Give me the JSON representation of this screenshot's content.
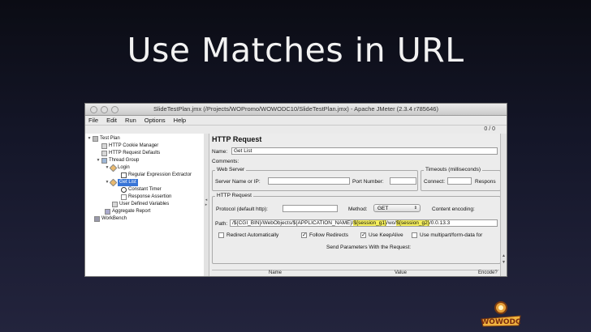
{
  "slide": {
    "title": "Use Matches in URL"
  },
  "window": {
    "title": "SlideTestPlan.jmx (/Projects/WOPromo/WOWODC10/SlideTestPlan.jmx) - Apache JMeter (2.3.4 r785646)",
    "menu": [
      "File",
      "Edit",
      "Run",
      "Options",
      "Help"
    ],
    "counter": "0 / 0"
  },
  "tree": {
    "items": [
      {
        "label": "Test Plan",
        "icon": "test-plan-icon"
      },
      {
        "label": "HTTP Cookie Manager",
        "icon": "config-element-icon"
      },
      {
        "label": "HTTP Request Defaults",
        "icon": "config-element-icon"
      },
      {
        "label": "Thread Group",
        "icon": "thread-group-icon"
      },
      {
        "label": "Login",
        "icon": "sampler-icon"
      },
      {
        "label": "Regular Expression Extractor",
        "icon": "post-processor-icon"
      },
      {
        "label": "Get List",
        "icon": "sampler-icon"
      },
      {
        "label": "Constant Timer",
        "icon": "timer-icon"
      },
      {
        "label": "Response Assertion",
        "icon": "assertion-icon"
      },
      {
        "label": "User Defined Variables",
        "icon": "config-element-icon"
      },
      {
        "label": "Aggregate Report",
        "icon": "listener-icon"
      },
      {
        "label": "WorkBench",
        "icon": "workbench-icon"
      }
    ]
  },
  "request": {
    "heading": "HTTP Request",
    "name_label": "Name:",
    "name_value": "Get List",
    "comments_label": "Comments:",
    "web_server": {
      "title": "Web Server",
      "server_label": "Server Name or IP:",
      "port_label": "Port Number:"
    },
    "timeouts": {
      "title": "Timeouts (milliseconds)",
      "connect_label": "Connect:",
      "response_label": "Respons"
    },
    "http_request": {
      "title": "HTTP Request",
      "protocol_label": "Protocol (default http):",
      "method_label": "Method:",
      "method_value": "GET",
      "encoding_label": "Content encoding:",
      "path_label": "Path:",
      "path_prefix": "/${CGI_BIN}/WebObjects/${APPLICATION_NAME}/",
      "path_var1": "${session_g1}",
      "path_mid": "/wo/",
      "path_var2": "${session_g2}",
      "path_suffix": "/0.0.13.3"
    },
    "options": [
      {
        "label": "Redirect Automatically",
        "checked": false
      },
      {
        "label": "Follow Redirects",
        "checked": true
      },
      {
        "label": "Use KeepAlive",
        "checked": true
      },
      {
        "label": "Use multipart/form-data for",
        "checked": false
      }
    ],
    "params_title": "Send Parameters With the Request:",
    "params_columns": [
      "Name",
      "Value",
      "Encode?"
    ]
  },
  "logo": {
    "text": "WOWODC"
  }
}
